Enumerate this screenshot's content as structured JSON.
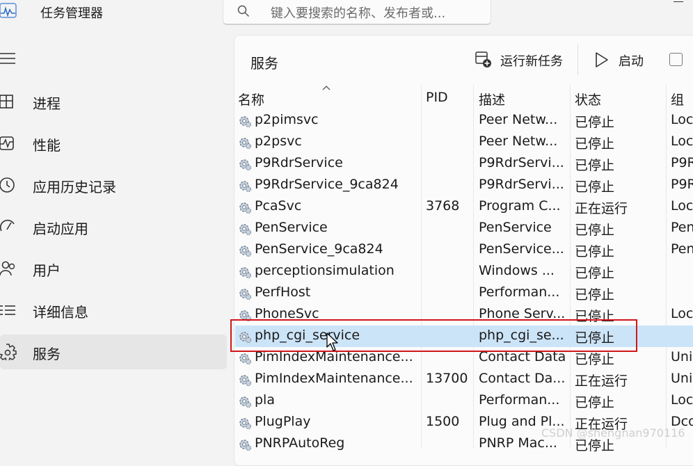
{
  "app": {
    "title": "任务管理器",
    "icon": "task-manager-icon"
  },
  "search": {
    "placeholder": "键入要搜索的名称、发布者或..."
  },
  "sidebar": {
    "items": [
      {
        "label": "进程",
        "icon": "processes-icon"
      },
      {
        "label": "性能",
        "icon": "performance-icon"
      },
      {
        "label": "应用历史记录",
        "icon": "app-history-icon"
      },
      {
        "label": "启动应用",
        "icon": "startup-apps-icon"
      },
      {
        "label": "用户",
        "icon": "users-icon"
      },
      {
        "label": "详细信息",
        "icon": "details-icon"
      },
      {
        "label": "服务",
        "icon": "services-icon",
        "selected": true
      }
    ]
  },
  "main": {
    "title": "服务",
    "toolbar": {
      "run_new_task": "运行新任务",
      "start": "启动"
    }
  },
  "table": {
    "columns": [
      "名称",
      "PID",
      "描述",
      "状态",
      "组"
    ],
    "rows": [
      {
        "name": "p2pimsvc",
        "pid": "",
        "desc": "Peer Netw...",
        "status": "已停止",
        "group": "Loc"
      },
      {
        "name": "p2psvc",
        "pid": "",
        "desc": "Peer Netw...",
        "status": "已停止",
        "group": "Loc"
      },
      {
        "name": "P9RdrService",
        "pid": "",
        "desc": "P9RdrServi...",
        "status": "已停止",
        "group": "P9R"
      },
      {
        "name": "P9RdrService_9ca824",
        "pid": "",
        "desc": "P9RdrServi...",
        "status": "已停止",
        "group": "P9R"
      },
      {
        "name": "PcaSvc",
        "pid": "3768",
        "desc": "Program C...",
        "status": "正在运行",
        "group": "Loc"
      },
      {
        "name": "PenService",
        "pid": "",
        "desc": "PenService",
        "status": "已停止",
        "group": "Pen"
      },
      {
        "name": "PenService_9ca824",
        "pid": "",
        "desc": "PenService...",
        "status": "已停止",
        "group": "Pen"
      },
      {
        "name": "perceptionsimulation",
        "pid": "",
        "desc": "Windows ...",
        "status": "已停止",
        "group": ""
      },
      {
        "name": "PerfHost",
        "pid": "",
        "desc": "Performan...",
        "status": "已停止",
        "group": ""
      },
      {
        "name": "PhoneSvc",
        "pid": "",
        "desc": "Phone Serv...",
        "status": "已停止",
        "group": "Loc"
      },
      {
        "name": "php_cgi_service",
        "pid": "",
        "desc": "php_cgi_se...",
        "status": "已停止",
        "group": "",
        "selected": true
      },
      {
        "name": "PimIndexMaintenance...",
        "pid": "",
        "desc": "Contact Data",
        "status": "已停止",
        "group": "Uni"
      },
      {
        "name": "PimIndexMaintenance...",
        "pid": "13700",
        "desc": "Contact Da...",
        "status": "正在运行",
        "group": "Uni"
      },
      {
        "name": "pla",
        "pid": "",
        "desc": "Performan...",
        "status": "已停止",
        "group": "Loc"
      },
      {
        "name": "PlugPlay",
        "pid": "1500",
        "desc": "Plug and Pl...",
        "status": "正在运行",
        "group": "Dco"
      },
      {
        "name": "PNRPAutoReg",
        "pid": "",
        "desc": "PNRP Mac...",
        "status": "已停止",
        "group": ""
      }
    ]
  },
  "watermark": "CSDN @shengnan970116",
  "colors": {
    "selected_row": "#cce4f7",
    "highlight": "#d0161b",
    "background": "#f3f3f3"
  }
}
